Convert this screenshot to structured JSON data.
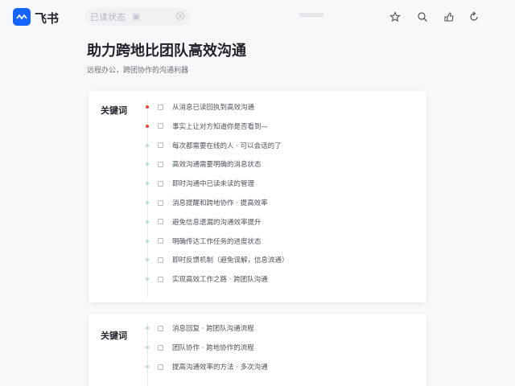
{
  "app": {
    "name": "飞书",
    "brand_color": "#1664ff"
  },
  "search": {
    "value": "已读状态"
  },
  "page": {
    "title": "助力跨地比团队高效沟通",
    "subtitle": "远程办公，跨团协作的沟通利器"
  },
  "cards": [
    {
      "label": "关键词",
      "rows": [
        {
          "text": "从消息已读回执到高效沟通",
          "dot": "#f04b3a"
        },
        {
          "text": "事实上让对方知道你是否看到—",
          "dot": "#f04b3a"
        },
        {
          "text": "每次都需要在线的人 · 可以会话的了",
          "dot": "#b9e0d3"
        },
        {
          "text": "高效沟通需要明确的消息状态",
          "dot": "#b9e0d3"
        },
        {
          "text": "即时沟通中已读未读的管理",
          "dot": "#b9e0d3"
        },
        {
          "text": "消息提醒和跨地协作 · 提高效率",
          "dot": "#b9e0d3"
        },
        {
          "text": "避免信息遗漏的沟通效率提升",
          "dot": "#b9e0d3"
        },
        {
          "text": "明确传达工作任务的进度状态",
          "dot": "#b9e0d3"
        },
        {
          "text": "即时反馈机制（避免误解，信息流通）",
          "dot": "#b9e0d3"
        },
        {
          "text": "实现高效工作之路 · 跨团队沟通",
          "dot": "#b9e0d3"
        }
      ]
    },
    {
      "label": "关键词",
      "rows": [
        {
          "text": "消息回复 · 跨团队沟通流程",
          "dot": "#b9e0d3"
        },
        {
          "text": "团队协作 · 跨地协作的流程",
          "dot": "#b9e0d3"
        },
        {
          "text": "提高沟通效率的方法 · 多次沟通",
          "dot": "#b9e0d3"
        }
      ]
    }
  ]
}
